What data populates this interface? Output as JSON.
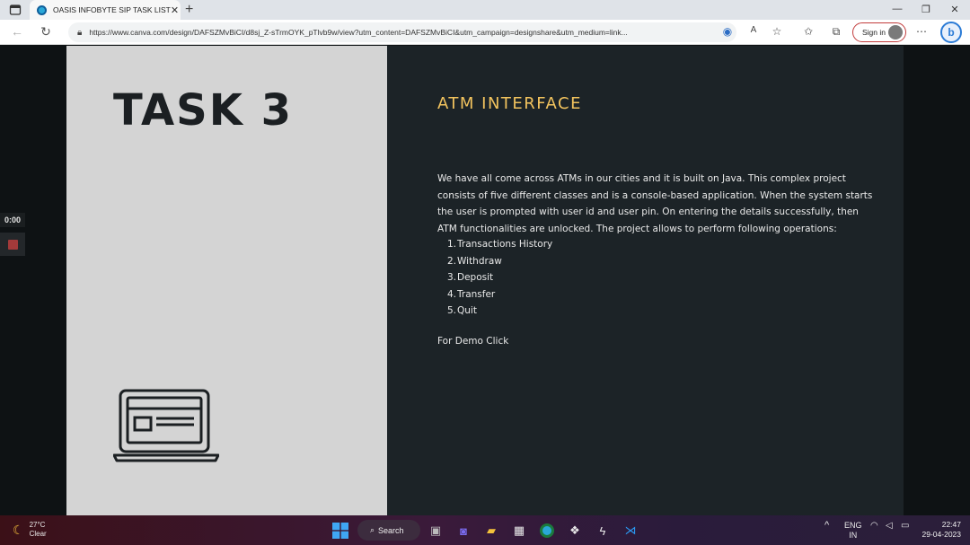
{
  "browser": {
    "tab_title": "OASIS INFOBYTE SIP TASK LIST",
    "tab_close": "✕",
    "new_tab": "+",
    "url": "https://www.canva.com/design/DAFSZMvBiCI/d8sj_Z-sTrmOYK_pTlvb9w/view?utm_content=DAFSZMvBiCI&utm_campaign=designshare&utm_medium=link...",
    "sign_in_label": "Sign in",
    "window_minimize": "—",
    "window_maximize": "❐",
    "window_close": "✕"
  },
  "player": {
    "timer": "0:00"
  },
  "slide": {
    "left_title": "TASK 3",
    "right_title": "ATM INTERFACE",
    "description": "We have all come across ATMs in our cities and it is built on Java. This complex project consists of five different classes and is a console-based application. When the system starts the user is prompted with user id and user pin. On entering the details successfully, then ATM functionalities are unlocked. The project allows to perform following operations:",
    "operations": [
      {
        "num": "1.",
        "label": "Transactions History"
      },
      {
        "num": "2.",
        "label": "Withdraw"
      },
      {
        "num": "3.",
        "label": "Deposit"
      },
      {
        "num": "4.",
        "label": "Transfer"
      },
      {
        "num": "5.",
        "label": "Quit"
      }
    ],
    "demo_link": "For Demo Click",
    "accent_color": "#f2c35e",
    "left_bg": "#d4d4d4",
    "right_bg": "#1c2327"
  },
  "taskbar": {
    "weather_temp": "27°C",
    "weather_cond": "Clear",
    "search_label": "Search",
    "lang_line1": "ENG",
    "lang_line2": "IN",
    "time": "22:47",
    "date": "29-04-2023"
  }
}
